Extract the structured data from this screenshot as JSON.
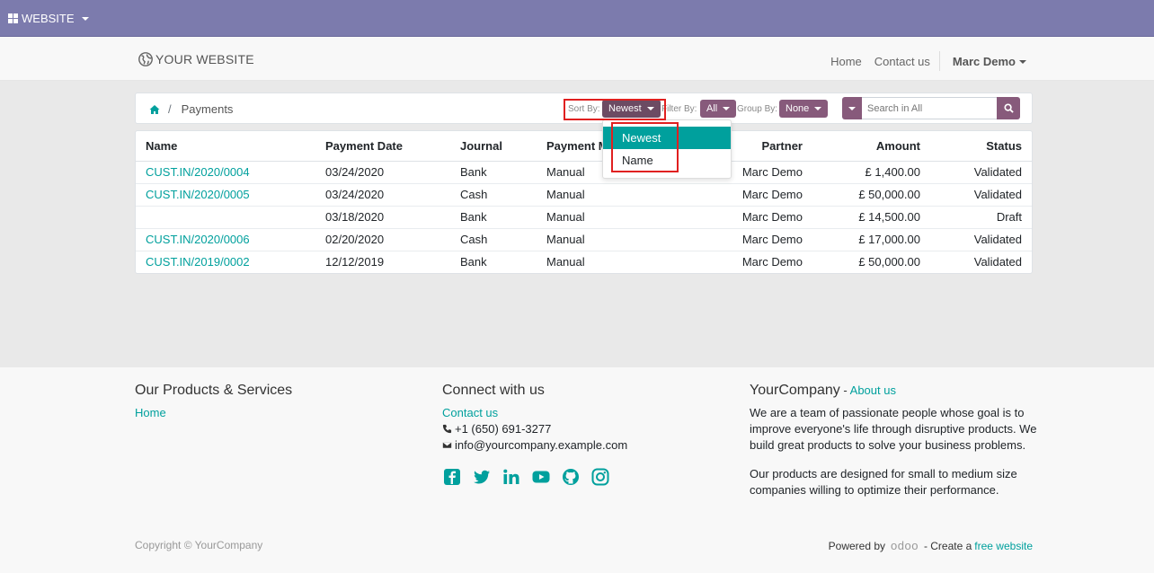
{
  "topbar": {
    "website_label": "WEBSITE"
  },
  "header": {
    "brand": "YOUR WEBSITE",
    "nav": {
      "home": "Home",
      "contact": "Contact us",
      "user": "Marc Demo"
    }
  },
  "breadcrumb": {
    "current": "Payments"
  },
  "controls": {
    "sort_label": "Sort By:",
    "sort_value": "Newest",
    "filter_label": "Filter By:",
    "filter_value": "All",
    "group_label": "Group By:",
    "group_value": "None",
    "search_placeholder": "Search in All"
  },
  "sort_dropdown": {
    "options": [
      "Newest",
      "Name"
    ],
    "selected": "Newest"
  },
  "table": {
    "headers": [
      "Name",
      "Payment Date",
      "Journal",
      "Payment M",
      "Partner",
      "Amount",
      "Status"
    ],
    "rows": [
      [
        "CUST.IN/2020/0004",
        "03/24/2020",
        "Bank",
        "Manual",
        "Marc Demo",
        "£ 1,400.00",
        "Validated"
      ],
      [
        "CUST.IN/2020/0005",
        "03/24/2020",
        "Cash",
        "Manual",
        "Marc Demo",
        "£ 50,000.00",
        "Validated"
      ],
      [
        "",
        "03/18/2020",
        "Bank",
        "Manual",
        "Marc Demo",
        "£ 14,500.00",
        "Draft"
      ],
      [
        "CUST.IN/2020/0006",
        "02/20/2020",
        "Cash",
        "Manual",
        "Marc Demo",
        "£ 17,000.00",
        "Validated"
      ],
      [
        "CUST.IN/2019/0002",
        "12/12/2019",
        "Bank",
        "Manual",
        "Marc Demo",
        "£ 50,000.00",
        "Validated"
      ]
    ]
  },
  "footer": {
    "col1": {
      "title": "Our Products & Services",
      "link": "Home"
    },
    "col2": {
      "title": "Connect with us",
      "contact_link": "Contact us",
      "phone": "+1 (650) 691-3277",
      "email": "info@yourcompany.example.com",
      "social_icons": [
        "facebook-icon",
        "twitter-icon",
        "linkedin-icon",
        "youtube-icon",
        "github-icon",
        "instagram-icon"
      ]
    },
    "col3": {
      "title": "YourCompany",
      "title_sep": " - ",
      "about_link": "About us",
      "para1": "We are a team of passionate people whose goal is to improve everyone's life through disruptive products. We build great products to solve your business problems.",
      "para2": "Our products are designed for small to medium size companies willing to optimize their performance."
    },
    "copyright": "Copyright © YourCompany",
    "powered_by": "Powered by",
    "odoo": "odoo",
    "create_text": "- Create a",
    "free_website": "free website"
  },
  "colors": {
    "topbar": "#7c7bad",
    "accent": "#00a09d",
    "button": "#875a7b",
    "highlight": "#e02020"
  }
}
